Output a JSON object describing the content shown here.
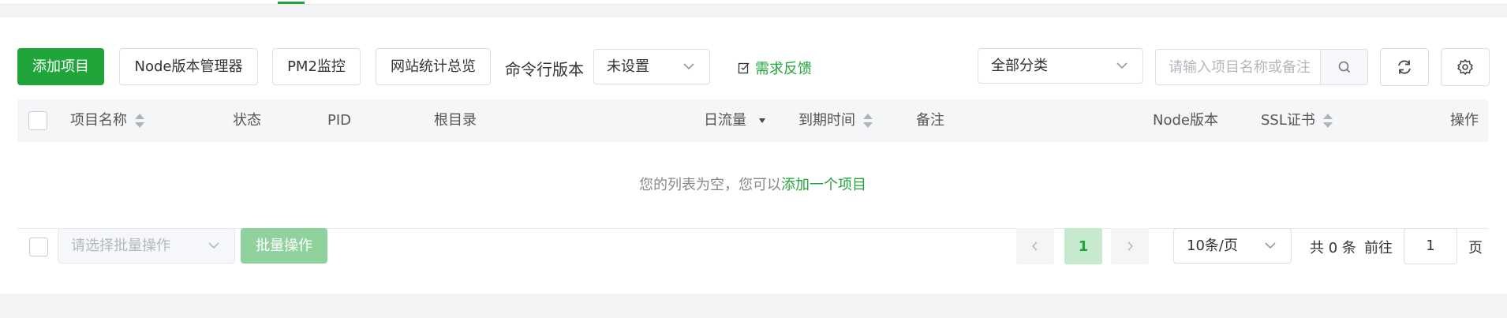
{
  "toolbar": {
    "add_project": "添加项目",
    "node_version_manager": "Node版本管理器",
    "pm2_monitor": "PM2监控",
    "site_stats": "网站统计总览",
    "cli_version_label": "命令行版本",
    "cli_version_value": "未设置",
    "feedback": "需求反馈",
    "category_select": "全部分类",
    "search_placeholder": "请输入项目名称或备注"
  },
  "table": {
    "headers": {
      "name": "项目名称",
      "status": "状态",
      "pid": "PID",
      "root": "根目录",
      "traffic": "日流量",
      "expire": "到期时间",
      "remark": "备注",
      "node_version": "Node版本",
      "ssl": "SSL证书",
      "actions": "操作"
    },
    "empty_prefix": "您的列表为空，您可以",
    "empty_link": "添加一个项目"
  },
  "footer": {
    "batch_select_placeholder": "请选择批量操作",
    "batch_button": "批量操作",
    "current_page": "1",
    "page_size": "10条/页",
    "total": "共 0 条",
    "goto_label": "前往",
    "goto_value": "1",
    "page_unit": "页"
  },
  "colors": {
    "accent": "#20a53a",
    "accent_light": "#c7e9cd"
  }
}
